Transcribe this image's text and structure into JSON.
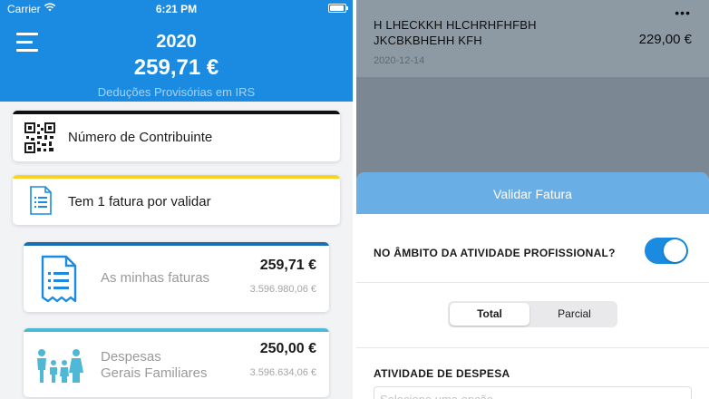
{
  "left_screen": {
    "status_bar": {
      "carrier": "Carrier",
      "time": "6:21 PM"
    },
    "header": {
      "year": "2020",
      "amount": "259,71 €",
      "subtitle": "Deduções Provisórias em IRS"
    },
    "cards": {
      "contribuinte": {
        "label": "Número de Contribuinte",
        "icon": "qr-code-icon"
      },
      "fatura": {
        "label": "Tem 1 fatura por validar",
        "icon": "invoice-icon",
        "accent": "#f5d327"
      },
      "minhas_faturas": {
        "label": "As minhas faturas",
        "amount": "259,71 €",
        "total": "3.596.980,06 €",
        "icon": "receipt-icon",
        "accent": "#1a6fb3"
      },
      "despesas": {
        "label_line1": "Despesas",
        "label_line2": "Gerais Familiares",
        "amount": "250,00 €",
        "total": "3.596.634,06 €",
        "icon": "family-icon",
        "accent": "#4fb8d6"
      }
    }
  },
  "right_screen": {
    "invoice": {
      "line1": "H LHECKKH HLCHRHFHFBH",
      "line2": "JKCBKBHEHH KFH",
      "amount": "229,00 €",
      "date": "2020-12-14"
    },
    "sheet": {
      "title": "Validar Fatura",
      "professional_question": "NO ÂMBITO DA ATIVIDADE PROFISSIONAL?",
      "professional_toggle_on": true,
      "segment": {
        "options": [
          "Total",
          "Parcial"
        ],
        "selected": "Total"
      },
      "activity_label": "ATIVIDADE DE DESPESA",
      "activity_placeholder": "Selecione uma opção"
    }
  },
  "colors": {
    "primary": "#1a8be0",
    "sheet_header": "#6aaee6"
  }
}
